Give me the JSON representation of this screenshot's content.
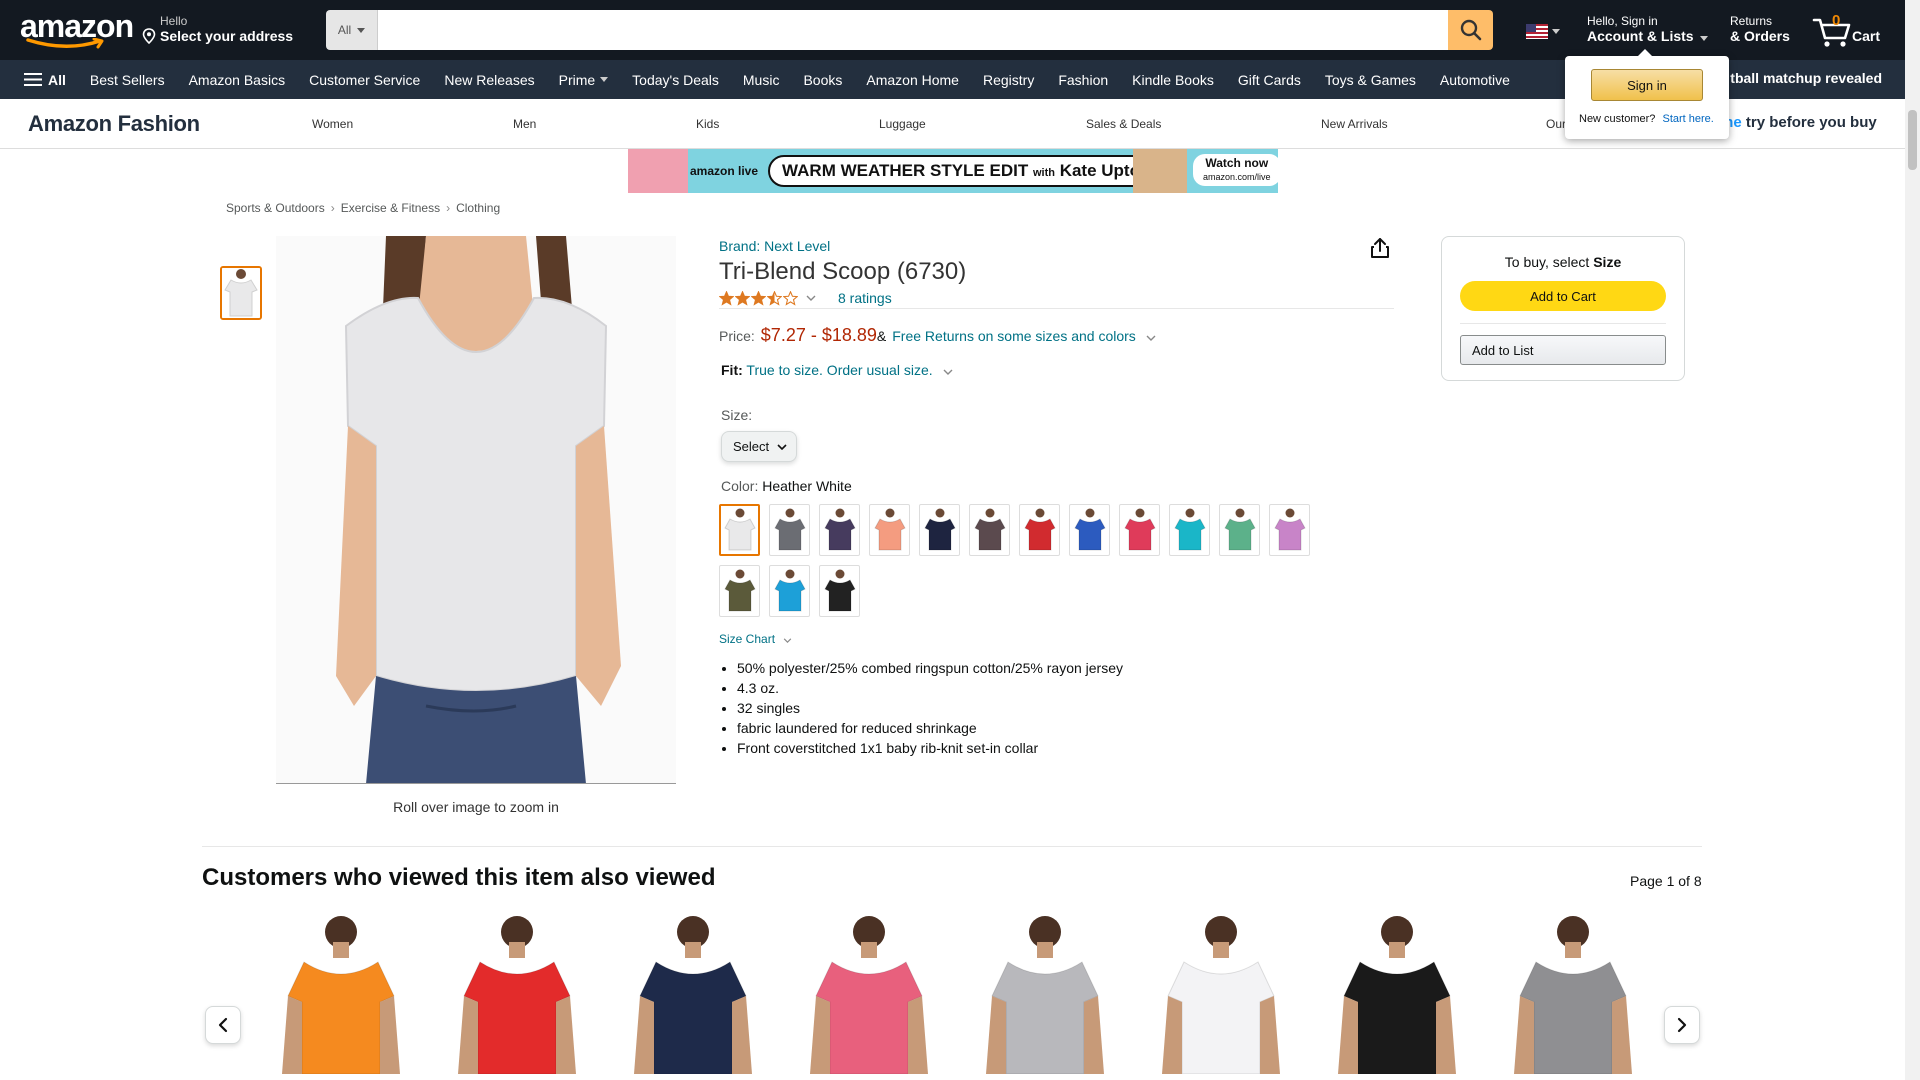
{
  "nav": {
    "logo": "amazon",
    "deliver_hello": "Hello",
    "deliver_address": "Select your address",
    "search_category": "All",
    "search_placeholder": "",
    "account_hello": "Hello, Sign in",
    "account_lists": "Account & Lists",
    "returns_l1": "Returns",
    "returns_l2": "& Orders",
    "cart_count": "0",
    "cart_label": "Cart"
  },
  "subnav": {
    "all": "All",
    "items": [
      "Best Sellers",
      "Amazon Basics",
      "Customer Service",
      "New Releases",
      "Prime",
      "Today's Deals",
      "Music",
      "Books",
      "Amazon Home",
      "Registry",
      "Fashion",
      "Kindle Books",
      "Gift Cards",
      "Toys & Games",
      "Automotive"
    ],
    "promo": "tball matchup revealed"
  },
  "fashion": {
    "title": "Amazon Fashion",
    "links": [
      "Women",
      "Men",
      "Kids",
      "Luggage",
      "Sales & Deals",
      "New Arrivals",
      "Our"
    ],
    "prime_fragment": "me",
    "prime_try": "try before you buy"
  },
  "banner": {
    "live": "amazon live",
    "headline": "WARM WEATHER STYLE EDIT",
    "with": "with",
    "host": "Kate Upton",
    "watch": "Watch now",
    "watch_url": "amazon.com/live"
  },
  "breadcrumb": [
    "Sports & Outdoors",
    "Exercise & Fitness",
    "Clothing"
  ],
  "product": {
    "brand": "Brand: Next Level",
    "title": "Tri-Blend Scoop (6730)",
    "rating_stars": 3.5,
    "ratings_count": "8 ratings",
    "price_label": "Price:",
    "price_range": "$7.27 - $18.89",
    "price_amp": "&",
    "free_returns": "Free Returns on some sizes and colors",
    "fit_label": "Fit:",
    "fit_value": "True to size. Order usual size.",
    "size_label": "Size:",
    "size_value": "Select",
    "color_label": "Color:",
    "color_value": "Heather White",
    "size_chart": "Size Chart",
    "zoom_hint": "Roll over image to zoom in",
    "bullets": [
      "50% polyester/25% combed ringspun cotton/25% rayon jersey",
      "4.3 oz.",
      "32 singles",
      "fabric laundered for reduced shrinkage",
      "Front coverstitched 1x1 baby rib-knit set-in collar"
    ],
    "swatch_colors": [
      "#e9e9ea",
      "#6b6d73",
      "#463b5e",
      "#f49c80",
      "#1e2440",
      "#5b4a4e",
      "#d12b2f",
      "#2c5bbf",
      "#df3b5a",
      "#1ab6c8",
      "#5cb18a",
      "#c884c8",
      "#5b5a3a",
      "#1da0d8",
      "#222222"
    ]
  },
  "buybox": {
    "head_prefix": "To buy, select",
    "head_bold": "Size",
    "add_to_cart": "Add to Cart",
    "add_to_list": "Add to List"
  },
  "flyout": {
    "sign_in": "Sign in",
    "new_customer": "New customer?",
    "start_here": "Start here."
  },
  "related": {
    "title": "Customers who viewed this item also viewed",
    "page": "Page 1 of 8",
    "shirt_colors": [
      "#f58a1f",
      "#e32b2b",
      "#1e2a4a",
      "#e8607d",
      "#b8b8bc",
      "#f3f3f5",
      "#1a1a1a",
      "#8f8f92"
    ]
  },
  "colors": {
    "nav_bg": "#131921",
    "subnav_bg": "#232f3e",
    "search_btn": "#febd69",
    "link": "#007185",
    "price": "#b12704",
    "cart_btn": "#ffd814",
    "cart_count": "#f08804"
  }
}
